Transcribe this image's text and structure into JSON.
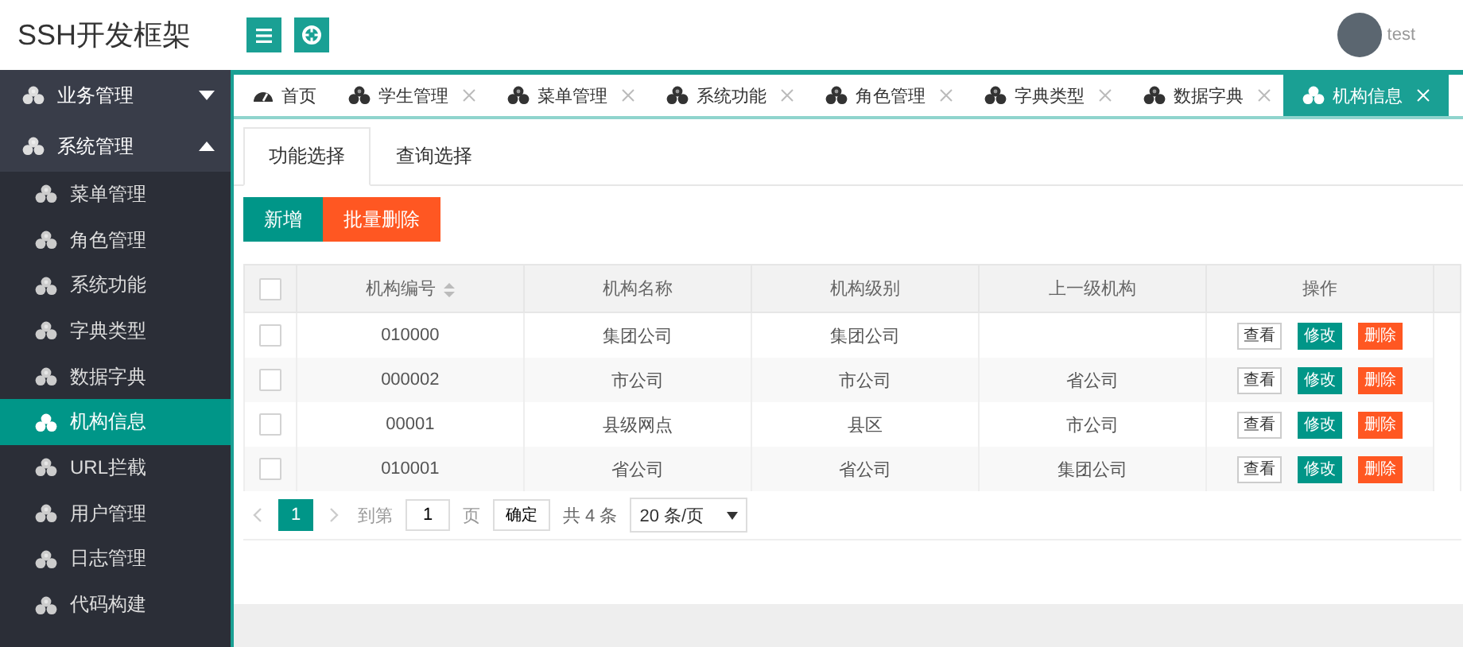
{
  "header": {
    "logo": "SSH开发框架",
    "user": "test"
  },
  "sidebar": {
    "items": [
      {
        "label": "业务管理",
        "expanded": false
      },
      {
        "label": "系统管理",
        "expanded": true,
        "children": [
          {
            "label": "菜单管理",
            "selected": false
          },
          {
            "label": "角色管理",
            "selected": false
          },
          {
            "label": "系统功能",
            "selected": false
          },
          {
            "label": "字典类型",
            "selected": false
          },
          {
            "label": "数据字典",
            "selected": false
          },
          {
            "label": "机构信息",
            "selected": true
          },
          {
            "label": "URL拦截",
            "selected": false
          },
          {
            "label": "用户管理",
            "selected": false
          },
          {
            "label": "日志管理",
            "selected": false
          },
          {
            "label": "代码构建",
            "selected": false
          }
        ]
      }
    ]
  },
  "tabs": [
    {
      "label": "首页",
      "kind": "home",
      "closable": false,
      "selected": false
    },
    {
      "label": "学生管理",
      "kind": "module",
      "closable": true,
      "selected": false
    },
    {
      "label": "菜单管理",
      "kind": "module",
      "closable": true,
      "selected": false
    },
    {
      "label": "系统功能",
      "kind": "module",
      "closable": true,
      "selected": false
    },
    {
      "label": "角色管理",
      "kind": "module",
      "closable": true,
      "selected": false
    },
    {
      "label": "字典类型",
      "kind": "module",
      "closable": true,
      "selected": false
    },
    {
      "label": "数据字典",
      "kind": "module",
      "closable": true,
      "selected": false
    },
    {
      "label": "机构信息",
      "kind": "module",
      "closable": true,
      "selected": true
    }
  ],
  "subtabs": [
    {
      "label": "功能选择",
      "selected": true
    },
    {
      "label": "查询选择",
      "selected": false
    }
  ],
  "toolbar": [
    {
      "label": "新增",
      "kind": "primary"
    },
    {
      "label": "批量删除",
      "kind": "danger"
    }
  ],
  "table": {
    "header_checked": false,
    "columns": [
      {
        "label": "机构编号",
        "sortable": true
      },
      {
        "label": "机构名称",
        "sortable": false
      },
      {
        "label": "机构级别",
        "sortable": false
      },
      {
        "label": "上一级机构",
        "sortable": false
      },
      {
        "label": "操作",
        "sortable": false
      }
    ],
    "rows": [
      {
        "checked": false,
        "cells": [
          "010000",
          "集团公司",
          "集团公司",
          ""
        ],
        "actions": [
          {
            "label": "查看",
            "kind": "view"
          },
          {
            "label": "修改",
            "kind": "edit"
          },
          {
            "label": "删除",
            "kind": "delete"
          }
        ]
      },
      {
        "checked": false,
        "cells": [
          "000002",
          "市公司",
          "市公司",
          "省公司"
        ],
        "actions": [
          {
            "label": "查看",
            "kind": "view"
          },
          {
            "label": "修改",
            "kind": "edit"
          },
          {
            "label": "删除",
            "kind": "delete"
          }
        ]
      },
      {
        "checked": false,
        "cells": [
          "00001",
          "县级网点",
          "县区",
          "市公司"
        ],
        "actions": [
          {
            "label": "查看",
            "kind": "view"
          },
          {
            "label": "修改",
            "kind": "edit"
          },
          {
            "label": "删除",
            "kind": "delete"
          }
        ]
      },
      {
        "checked": false,
        "cells": [
          "010001",
          "省公司",
          "省公司",
          "集团公司"
        ],
        "actions": [
          {
            "label": "查看",
            "kind": "view"
          },
          {
            "label": "修改",
            "kind": "edit"
          },
          {
            "label": "删除",
            "kind": "delete"
          }
        ]
      }
    ]
  },
  "pagination": {
    "pages": [
      {
        "label": "1",
        "selected": true
      }
    ],
    "goto_label": "到第",
    "goto_value": "1",
    "page_unit": "页",
    "confirm": "确定",
    "total": "共 4 条",
    "page_size": "20 条/页"
  }
}
